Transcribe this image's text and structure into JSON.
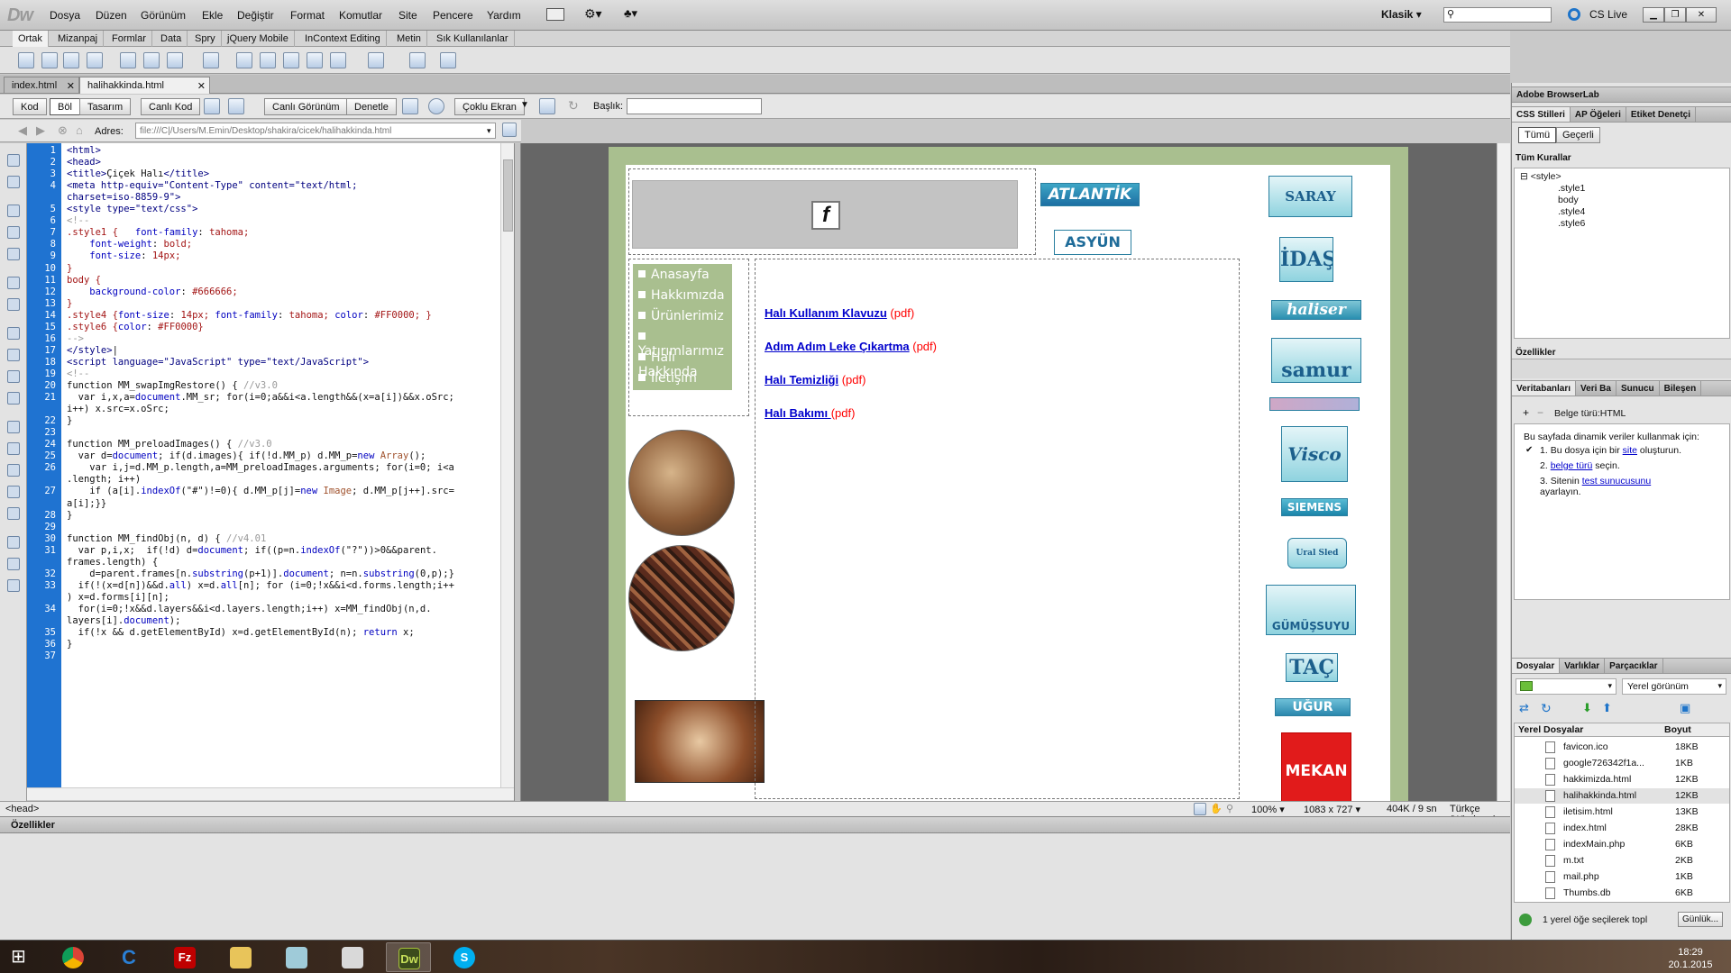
{
  "app": {
    "logo": "Dw"
  },
  "menubar": {
    "items": [
      "Dosya",
      "Düzen",
      "Görünüm",
      "Ekle",
      "Değiştir",
      "Format",
      "Komutlar",
      "Site",
      "Pencere",
      "Yardım"
    ],
    "workspace": "Klasik",
    "cs_live": "CS Live"
  },
  "insert_tabs": [
    "Ortak",
    "Mizanpaj",
    "Formlar",
    "Data",
    "Spry",
    "jQuery Mobile",
    "InContext Editing",
    "Metin",
    "Sık Kullanılanlar"
  ],
  "doc_tabs": [
    {
      "label": "index.html"
    },
    {
      "label": "halihakkinda.html"
    }
  ],
  "doc_toolbar": {
    "code": "Kod",
    "split": "Böl",
    "design": "Tasarım",
    "live_code": "Canlı Kod",
    "live_view": "Canlı Görünüm",
    "inspect": "Denetle",
    "multiscreen": "Çoklu Ekran",
    "title_label": "Başlık:",
    "title_value": ""
  },
  "address": {
    "label": "Adres:",
    "value": "file:///C|/Users/M.Emin/Desktop/shakira/cicek/halihakkinda.html"
  },
  "code_lines": [
    {
      "n": "1",
      "html": "<span class='t'>&lt;html&gt;</span>"
    },
    {
      "n": "2",
      "html": "<span class='t'>&lt;head&gt;</span>"
    },
    {
      "n": "3",
      "html": "<span class='t'>&lt;title&gt;</span>Çiçek Halı<span class='t'>&lt;/title&gt;</span>"
    },
    {
      "n": "4",
      "html": "<span class='t'>&lt;meta http-equiv=\"Content-Type\" content=\"text/html;</span>"
    },
    {
      "n": "",
      "html": "<span class='t'>charset=iso-8859-9\"&gt;</span>"
    },
    {
      "n": "5",
      "html": "<span class='t'>&lt;style type=\"text/css\"&gt;</span>"
    },
    {
      "n": "6",
      "html": "<span class='c'>&lt;!--</span>"
    },
    {
      "n": "7",
      "html": "<span class='f'>.style1 {</span>   <span class='b'>font-family</span>: <span class='f'>tahoma;</span>"
    },
    {
      "n": "8",
      "html": "    <span class='b'>font-weight</span>: <span class='f'>bold;</span>"
    },
    {
      "n": "9",
      "html": "    <span class='b'>font-size</span>: <span class='f'>14px;</span>"
    },
    {
      "n": "10",
      "html": "<span class='f'>}</span>"
    },
    {
      "n": "11",
      "html": "<span class='f'>body {</span>"
    },
    {
      "n": "12",
      "html": "    <span class='b'>background-color</span>: <span class='f'>#666666;</span>"
    },
    {
      "n": "13",
      "html": "<span class='f'>}</span>"
    },
    {
      "n": "14",
      "html": "<span class='f'>.style4 {</span><span class='b'>font-size</span>: <span class='f'>14px;</span> <span class='b'>font-family</span>: <span class='f'>tahoma;</span> <span class='b'>color</span>: <span class='f'>#FF0000; }</span>"
    },
    {
      "n": "15",
      "html": "<span class='f'>.style6 {</span><span class='b'>color</span>: <span class='f'>#FF0000}</span>"
    },
    {
      "n": "16",
      "html": "<span class='c'>--&gt;</span>"
    },
    {
      "n": "17",
      "html": "<span class='t'>&lt;/style&gt;</span>|"
    },
    {
      "n": "18",
      "html": "<span class='t'>&lt;script language=\"JavaScript\" type=\"text/JavaScript\"&gt;</span>"
    },
    {
      "n": "19",
      "html": "<span class='c'>&lt;!--</span>"
    },
    {
      "n": "20",
      "html": "function MM_swapImgRestore() { <span class='c'>//v3.0</span>"
    },
    {
      "n": "21",
      "html": "  var i,x,a=<span class='b'>document</span>.MM_sr; for(i=0;a&amp;&amp;i&lt;a.length&amp;&amp;(x=a[i])&amp;&amp;x.oSrc;"
    },
    {
      "n": "",
      "html": "i++) x.src=x.oSrc;"
    },
    {
      "n": "22",
      "html": "}"
    },
    {
      "n": "23",
      "html": ""
    },
    {
      "n": "24",
      "html": "function MM_preloadImages() { <span class='c'>//v3.0</span>"
    },
    {
      "n": "25",
      "html": "  var d=<span class='b'>document</span>; if(d.images){ if(!d.MM_p) d.MM_p=<span class='b'>new</span> <span class='s'>Array</span>();"
    },
    {
      "n": "26",
      "html": "    var i,j=d.MM_p.length,a=MM_preloadImages.arguments; for(i=0; i&lt;a"
    },
    {
      "n": "",
      "html": ".length; i++)"
    },
    {
      "n": "27",
      "html": "    if (a[i].<span class='b'>indexOf</span>(\"#\")!=0){ d.MM_p[j]=<span class='b'>new</span> <span class='s'>Image</span>; d.MM_p[j++].src="
    },
    {
      "n": "",
      "html": "a[i];}}"
    },
    {
      "n": "28",
      "html": "}"
    },
    {
      "n": "29",
      "html": ""
    },
    {
      "n": "30",
      "html": "function MM_findObj(n, d) { <span class='c'>//v4.01</span>"
    },
    {
      "n": "31",
      "html": "  var p,i,x;  if(!d) d=<span class='b'>document</span>; if((p=n.<span class='b'>indexOf</span>(\"?\"))&gt;0&amp;&amp;parent."
    },
    {
      "n": "",
      "html": "frames.length) {"
    },
    {
      "n": "32",
      "html": "    d=parent.frames[n.<span class='b'>substring</span>(p+1)].<span class='b'>document</span>; n=n.<span class='b'>substring</span>(0,p);}"
    },
    {
      "n": "33",
      "html": "  if(!(x=d[n])&amp;&amp;d.<span class='b'>all</span>) x=d.<span class='b'>all</span>[n]; for (i=0;!x&amp;&amp;i&lt;d.forms.length;i++"
    },
    {
      "n": "",
      "html": ") x=d.forms[i][n];"
    },
    {
      "n": "34",
      "html": "  for(i=0;!x&amp;&amp;d.layers&amp;&amp;i&lt;d.layers.length;i++) x=MM_findObj(n,d."
    },
    {
      "n": "",
      "html": "layers[i].<span class='b'>document</span>);"
    },
    {
      "n": "35",
      "html": "  if(!x &amp;&amp; d.getElementById) x=d.getElementById(n); <span class='b'>return</span> x;"
    },
    {
      "n": "36",
      "html": "}"
    },
    {
      "n": "37",
      "html": ""
    }
  ],
  "tag_selector": "<head>",
  "design": {
    "nav": [
      "Anasayfa",
      "Hakkımızda",
      "Ürünlerimiz",
      "Yatırımlarımız",
      "Halı Hakkında",
      "İletişim"
    ],
    "links": [
      {
        "text": "Halı Kullanım Klavuzu",
        "suffix": " (pdf)"
      },
      {
        "text": "Adım Adım Leke Çıkartma",
        "suffix": " (pdf)"
      },
      {
        "text": "Halı Temizliği",
        "suffix": " (pdf)"
      },
      {
        "text": "Halı Bakımı ",
        "suffix": "(pdf)"
      }
    ],
    "logos_top": [
      "ATLANTİK",
      "ASYÜN"
    ],
    "logos_right": [
      "SARAY HALI",
      "İDAŞ",
      "haliser",
      "samur",
      "",
      "Visco",
      "SIEMENS",
      "Ural Sled",
      "GÜMÜŞSUYU",
      "TAÇ",
      "UĞUR",
      "MEKAN"
    ],
    "bg_color": "#666666",
    "page_green": "#a9bf8f",
    "link_color": "#0000cc",
    "pdf_color": "#ff0000"
  },
  "status": {
    "zoom": "100%",
    "size": "1083 x 727",
    "weight": "404K / 9 sn",
    "encoding": "Türkçe (Windows)"
  },
  "properties_label": "Özellikler",
  "right_panel": {
    "browserlab": "Adobe BrowserLab",
    "css_tabs": [
      "CSS Stilleri",
      "AP Öğeleri",
      "Etiket Denetçi"
    ],
    "css_modes": [
      "Tümü",
      "Geçerli"
    ],
    "all_rules": "Tüm Kurallar",
    "rules": [
      "<style>",
      ".style1",
      "body",
      ".style4",
      ".style6"
    ],
    "props": "Özellikler",
    "db_tabs": [
      "Veritabanları",
      "Veri Ba",
      "Sunucu",
      "Bileşen"
    ],
    "doc_type": "Belge türü:HTML",
    "db_text": "Bu sayfada dinamik veriler kullanmak için:",
    "steps": [
      {
        "n": "1.",
        "pre": "Bu dosya için bir ",
        "link": "site",
        "post": " oluşturun."
      },
      {
        "n": "2.",
        "pre": "",
        "link": "belge türü",
        "post": " seçin."
      },
      {
        "n": "3.",
        "pre": "Sitenin ",
        "link": "test sunucusunu",
        "post": " ayarlayın."
      }
    ],
    "file_tabs": [
      "Dosyalar",
      "Varlıklar",
      "Parçacıklar"
    ],
    "view": "Yerel görünüm",
    "files_header": "Yerel Dosyalar",
    "size_header": "Boyut",
    "files": [
      {
        "name": "favicon.ico",
        "size": "18KB"
      },
      {
        "name": "google726342f1a...",
        "size": "1KB"
      },
      {
        "name": "hakkimizda.html",
        "size": "12KB"
      },
      {
        "name": "halihakkinda.html",
        "size": "12KB"
      },
      {
        "name": "iletisim.html",
        "size": "13KB"
      },
      {
        "name": "index.html",
        "size": "28KB"
      },
      {
        "name": "indexMain.php",
        "size": "6KB"
      },
      {
        "name": "m.txt",
        "size": "2KB"
      },
      {
        "name": "mail.php",
        "size": "1KB"
      },
      {
        "name": "Thumbs.db",
        "size": "6KB"
      }
    ],
    "status_text": "1 yerel öğe seçilerek topl",
    "log_button": "Günlük..."
  },
  "taskbar": {
    "time": "18:29",
    "date": "20.1.2015"
  }
}
